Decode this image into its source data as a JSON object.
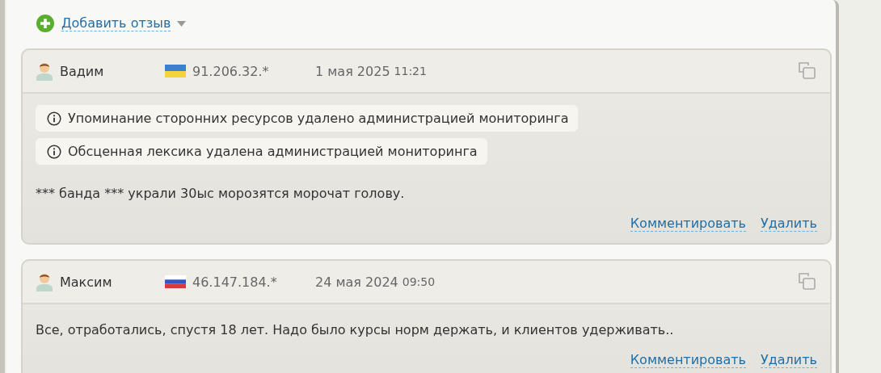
{
  "add_review": {
    "label": "Добавить отзыв"
  },
  "reviews": [
    {
      "author": "Вадим",
      "flag": {
        "kind": "ua"
      },
      "ip": "91.206.32.*",
      "date": "1 мая 2025",
      "time": "11:21",
      "notices": [
        "Упоминание сторонних ресурсов удалено администрацией мониторинга",
        "Обсценная лексика удалена администрацией мониторинга"
      ],
      "text": "*** банда *** украли 30ыс морозятся морочат голову.",
      "actions": [
        "Комментировать",
        "Удалить"
      ]
    },
    {
      "author": "Максим",
      "flag": {
        "kind": "ru"
      },
      "ip": "46.147.184.*",
      "date": "24 мая 2024",
      "time": "09:50",
      "text": "Все, отработались, спустя 18 лет. Надо было курсы норм держать, и клиентов удерживать..",
      "actions": [
        "Комментировать",
        "Удалить"
      ]
    }
  ]
}
